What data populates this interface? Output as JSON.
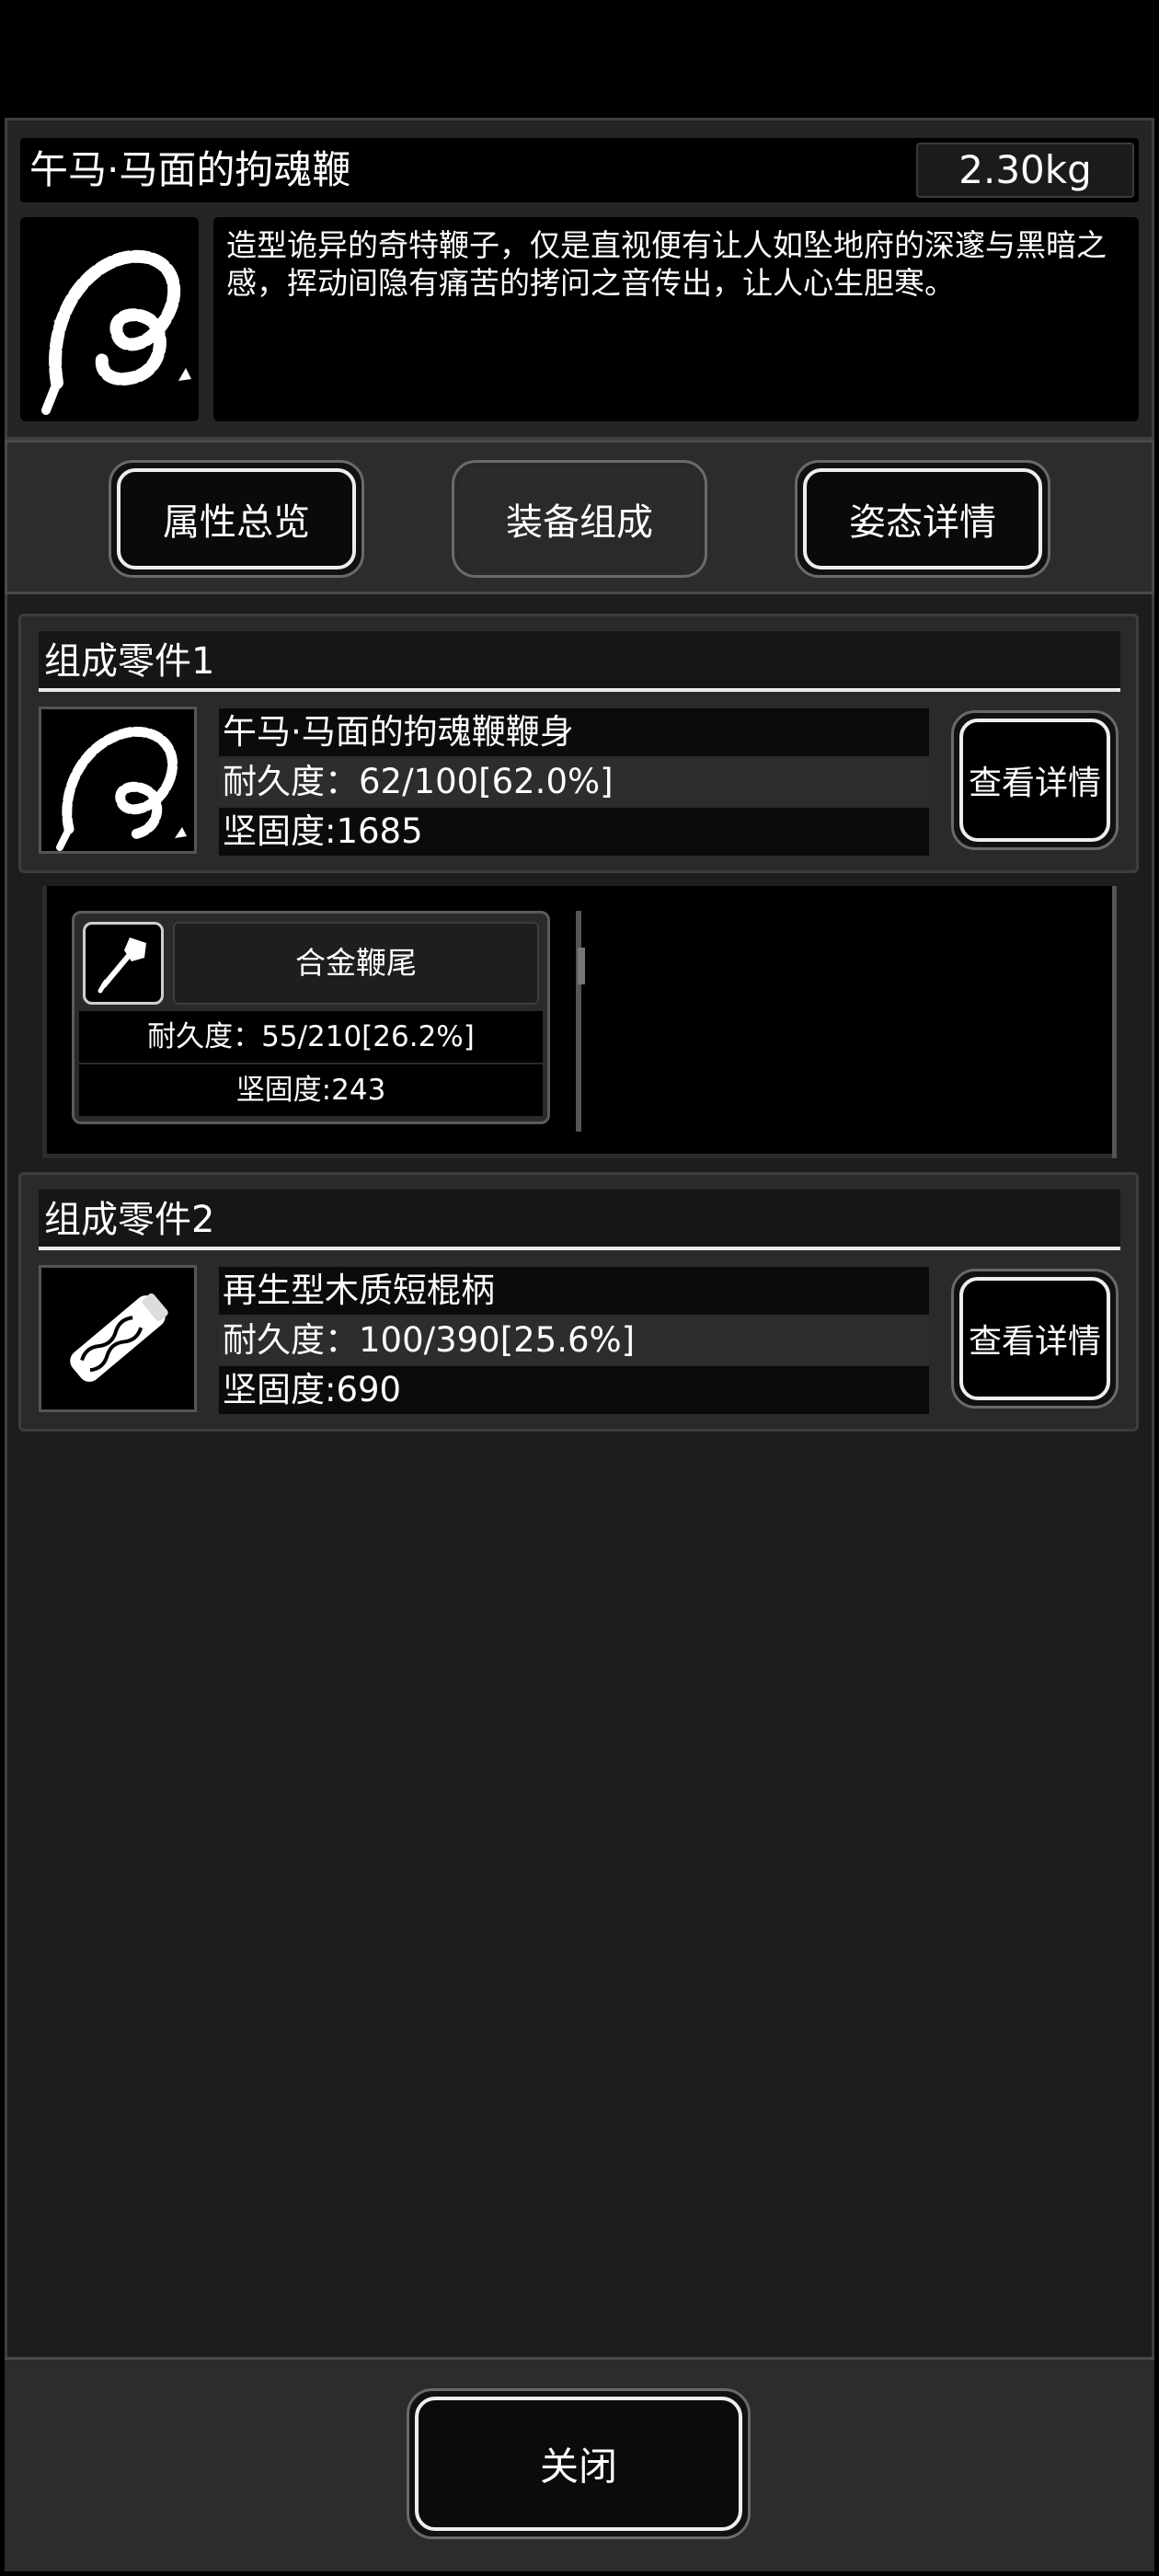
{
  "item": {
    "name": "午马·马面的拘魂鞭",
    "weight": "2.30kg",
    "description": "造型诡异的奇特鞭子，仅是直视便有让人如坠地府的深邃与黑暗之感，挥动间隐有痛苦的拷问之音传出，让人心生胆寒。",
    "icon": "whip-icon"
  },
  "tabs": [
    {
      "label": "属性总览",
      "active": false
    },
    {
      "label": "装备组成",
      "active": true
    },
    {
      "label": "姿态详情",
      "active": false
    }
  ],
  "parts": [
    {
      "header": "组成零件1",
      "name": "午马·马面的拘魂鞭鞭身",
      "durability": "耐久度：62/100[62.0%]",
      "hardness": "坚固度:1685",
      "button": "查看详情",
      "icon": "whip-body-icon"
    },
    {
      "header": "组成零件2",
      "name": "再生型木质短棍柄",
      "durability": "耐久度：100/390[25.6%]",
      "hardness": "坚固度:690",
      "button": "查看详情",
      "icon": "wooden-handle-icon"
    }
  ],
  "subpart": {
    "name": "合金鞭尾",
    "durability": "耐久度：55/210[26.2%]",
    "hardness": "坚固度:243",
    "icon": "whip-tail-icon"
  },
  "footer": {
    "close_label": "关闭"
  }
}
